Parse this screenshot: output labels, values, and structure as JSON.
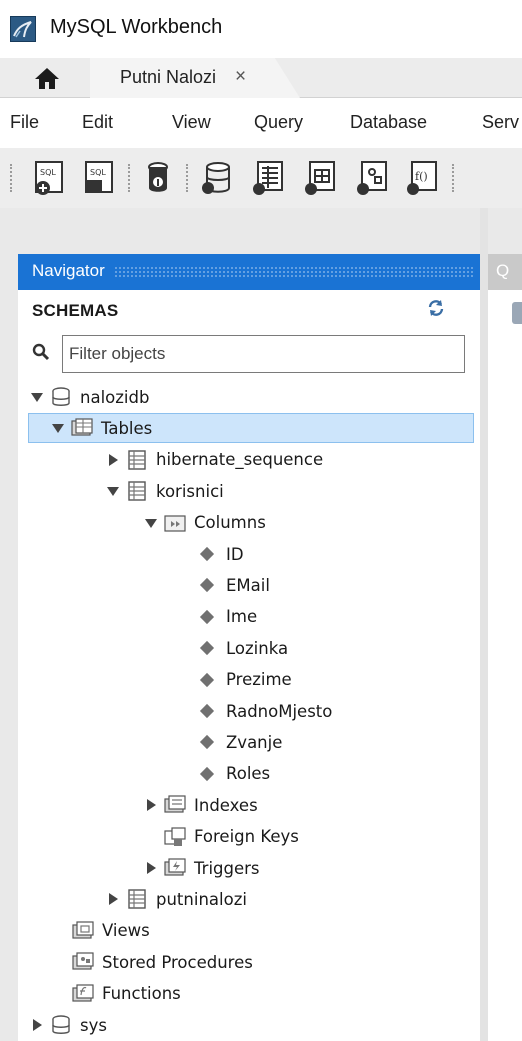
{
  "window": {
    "title": "MySQL Workbench",
    "icon": "mysql-workbench-icon"
  },
  "tabs": {
    "home_icon": "home-icon",
    "document_tab": {
      "label": "Putni Nalozi",
      "close": "×"
    }
  },
  "menu": [
    "File",
    "Edit",
    "View",
    "Query",
    "Database",
    "Serv"
  ],
  "toolbar": {
    "buttons": [
      "new-sql-tab-icon",
      "open-sql-script-icon",
      "schema-inspector-icon",
      "create-schema-icon",
      "create-table-icon",
      "create-view-icon",
      "create-procedure-icon",
      "create-function-icon"
    ]
  },
  "navigator": {
    "title": "Navigator",
    "schemas_label": "SCHEMAS",
    "filter_placeholder": "Filter objects",
    "tree": [
      {
        "label": "nalozidb",
        "level": 0,
        "arrow": "down",
        "icon": "database-icon"
      },
      {
        "label": "Tables",
        "level": 1,
        "arrow": "down",
        "icon": "tables-folder-icon",
        "selected": true
      },
      {
        "label": "hibernate_sequence",
        "level": 2,
        "arrow": "right",
        "icon": "table-icon"
      },
      {
        "label": "korisnici",
        "level": 2,
        "arrow": "down",
        "icon": "table-icon"
      },
      {
        "label": "Columns",
        "level": 3,
        "arrow": "down",
        "icon": "columns-folder-icon"
      },
      {
        "label": "ID",
        "level": 4,
        "arrow": "none",
        "icon": "column-icon"
      },
      {
        "label": "EMail",
        "level": 4,
        "arrow": "none",
        "icon": "column-icon"
      },
      {
        "label": "Ime",
        "level": 4,
        "arrow": "none",
        "icon": "column-icon"
      },
      {
        "label": "Lozinka",
        "level": 4,
        "arrow": "none",
        "icon": "column-icon"
      },
      {
        "label": "Prezime",
        "level": 4,
        "arrow": "none",
        "icon": "column-icon"
      },
      {
        "label": "RadnoMjesto",
        "level": 4,
        "arrow": "none",
        "icon": "column-icon"
      },
      {
        "label": "Zvanje",
        "level": 4,
        "arrow": "none",
        "icon": "column-icon"
      },
      {
        "label": "Roles",
        "level": 4,
        "arrow": "none",
        "icon": "column-icon"
      },
      {
        "label": "Indexes",
        "level": 3,
        "arrow": "right",
        "icon": "indexes-folder-icon"
      },
      {
        "label": "Foreign Keys",
        "level": 3,
        "arrow": "none",
        "icon": "foreign-keys-icon"
      },
      {
        "label": "Triggers",
        "level": 3,
        "arrow": "right",
        "icon": "triggers-folder-icon"
      },
      {
        "label": "putninalozi",
        "level": 2,
        "arrow": "right",
        "icon": "table-icon"
      },
      {
        "label": "Views",
        "level": 1,
        "arrow": "none",
        "icon": "views-folder-icon"
      },
      {
        "label": "Stored Procedures",
        "level": 1,
        "arrow": "none",
        "icon": "procedures-folder-icon"
      },
      {
        "label": "Functions",
        "level": 1,
        "arrow": "none",
        "icon": "functions-folder-icon"
      },
      {
        "label": "sys",
        "level": 0,
        "arrow": "right",
        "icon": "database-icon"
      }
    ]
  },
  "query_panel": {
    "tab_label": "Q"
  },
  "colors": {
    "accent": "#1a73d4",
    "selection": "#cde5fb",
    "selection_border": "#8cc0ee"
  }
}
